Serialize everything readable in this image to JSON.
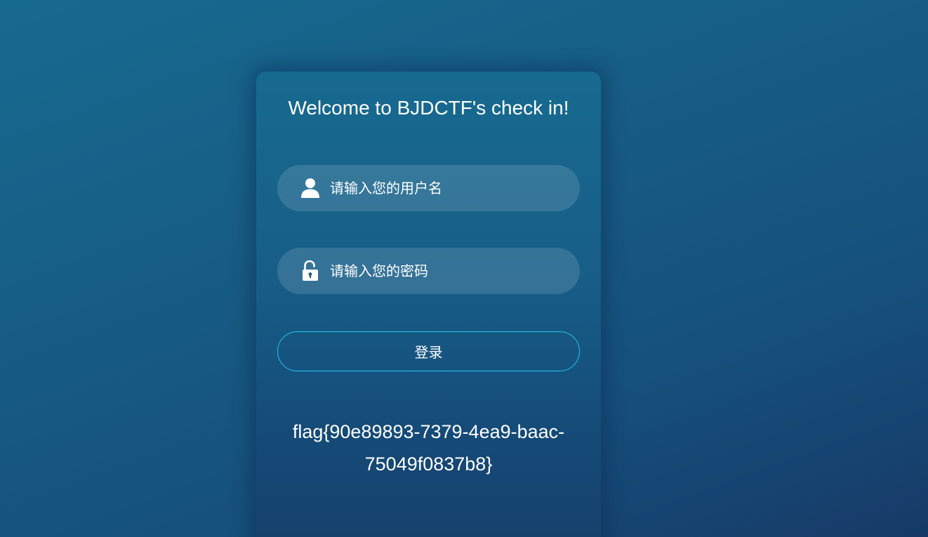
{
  "login": {
    "title": "Welcome to BJDCTF's check in!",
    "username": {
      "placeholder": "请输入您的用户名",
      "value": "",
      "icon": "user-icon"
    },
    "password": {
      "placeholder": "请输入您的密码",
      "value": "",
      "icon": "unlocked-padlock-icon"
    },
    "submit_label": "登录",
    "flag_text": "flag{90e89893-7379-4ea9-baac-75049f0837b8}"
  },
  "colors": {
    "background_top": "#176a90",
    "background_bottom": "#173a68",
    "button_border": "#22c4f0",
    "text": "#ffffff"
  }
}
